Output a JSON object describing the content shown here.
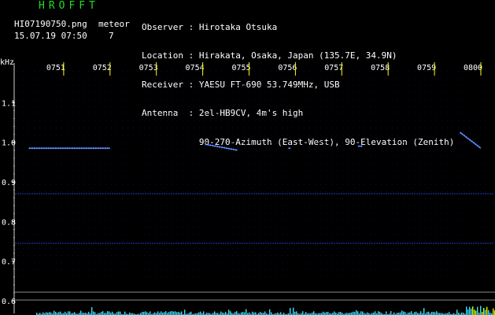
{
  "app": {
    "name": "HROFFT"
  },
  "file": {
    "name": "HI07190750.png",
    "datetime": "15.07.19 07:50"
  },
  "meteor": {
    "label": "meteor",
    "count": "7"
  },
  "station": {
    "rows": [
      "Observer : Hirotaka Otsuka",
      "Location : Hirakata, Osaka, Japan (135.7E, 34.9N)",
      "Receiver : YAESU FT-690 53.749MHz, USB",
      "Antenna  : 2el-HB9CV, 4m's high",
      "           90-270-Azimuth (East-West), 90-Elevation (Zenith)"
    ]
  },
  "colors": {
    "logo": "#22dd22",
    "text": "#ffffff",
    "time_marker": "#ffff00",
    "echo": "#3b5bff",
    "echo_bright": "#8fd8ff",
    "histogram": "#33e0ff",
    "histogram_peak": "#ccff00",
    "dots": "#0a0a4a"
  },
  "chart_data": {
    "type": "spectrogram",
    "y_unit": "kHz",
    "time_labels": [
      "0751",
      "0752",
      "0753",
      "0754",
      "0755",
      "0756",
      "0757",
      "0758",
      "0759",
      "0800"
    ],
    "freq_ticks": [
      "1.1",
      "1.0",
      "0.9",
      "0.8",
      "0.7",
      "0.6"
    ],
    "freq_values": [
      1.1,
      1.0,
      0.9,
      0.8,
      0.7,
      0.6
    ],
    "ylim": [
      0.58,
      1.2
    ],
    "xlim_minutes": [
      0,
      10
    ],
    "carrier_lines_khz": [
      0.87,
      0.745
    ],
    "echoes": [
      {
        "t_start": 0.25,
        "t_end": 2.0,
        "f_start": 0.985,
        "f_end": 0.985
      },
      {
        "t_start": 4.05,
        "t_end": 4.75,
        "f_start": 0.995,
        "f_end": 0.98
      },
      {
        "t_start": 9.55,
        "t_end": 10.0,
        "f_start": 1.025,
        "f_end": 0.985
      },
      {
        "t_start": 7.35,
        "t_end": 7.45,
        "f_start": 0.99,
        "f_end": 0.99
      },
      {
        "t_start": 5.85,
        "t_end": 5.9,
        "f_start": 0.985,
        "f_end": 0.985
      }
    ]
  }
}
